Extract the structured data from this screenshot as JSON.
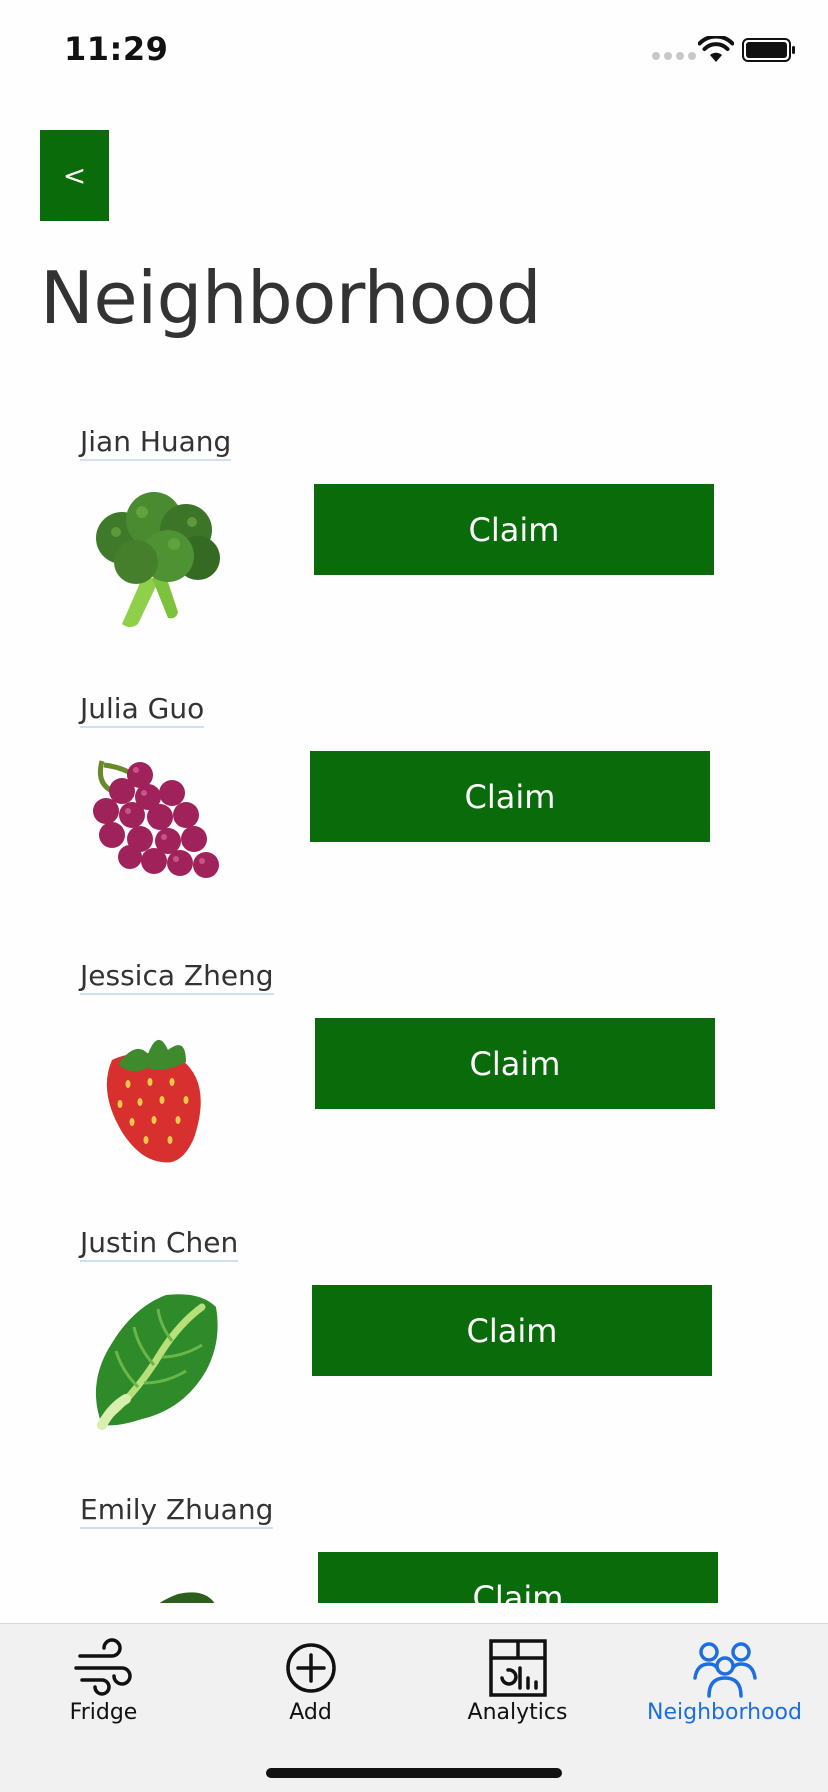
{
  "status_bar": {
    "time": "11:29"
  },
  "header": {
    "back_label": "<",
    "title": "Neighborhood"
  },
  "listings": [
    {
      "owner": "Jian Huang",
      "item_icon": "broccoli-icon",
      "claim_label": "Claim"
    },
    {
      "owner": "Julia Guo",
      "item_icon": "grapes-icon",
      "claim_label": "Claim"
    },
    {
      "owner": "Jessica Zheng",
      "item_icon": "strawberry-icon",
      "claim_label": "Claim"
    },
    {
      "owner": "Justin Chen",
      "item_icon": "leafy-green-icon",
      "claim_label": "Claim"
    },
    {
      "owner": "Emily Zhuang",
      "item_icon": "avocado-icon",
      "claim_label": "Claim"
    }
  ],
  "tab_bar": {
    "tabs": [
      {
        "label": "Fridge",
        "icon": "wind-icon",
        "active": false
      },
      {
        "label": "Add",
        "icon": "plus-circle-icon",
        "active": false
      },
      {
        "label": "Analytics",
        "icon": "analytics-icon",
        "active": false
      },
      {
        "label": "Neighborhood",
        "icon": "people-icon",
        "active": true
      }
    ]
  },
  "colors": {
    "accent_green": "#0a6b0a",
    "active_tab_blue": "#1d6fe0",
    "title_text": "#333333"
  }
}
